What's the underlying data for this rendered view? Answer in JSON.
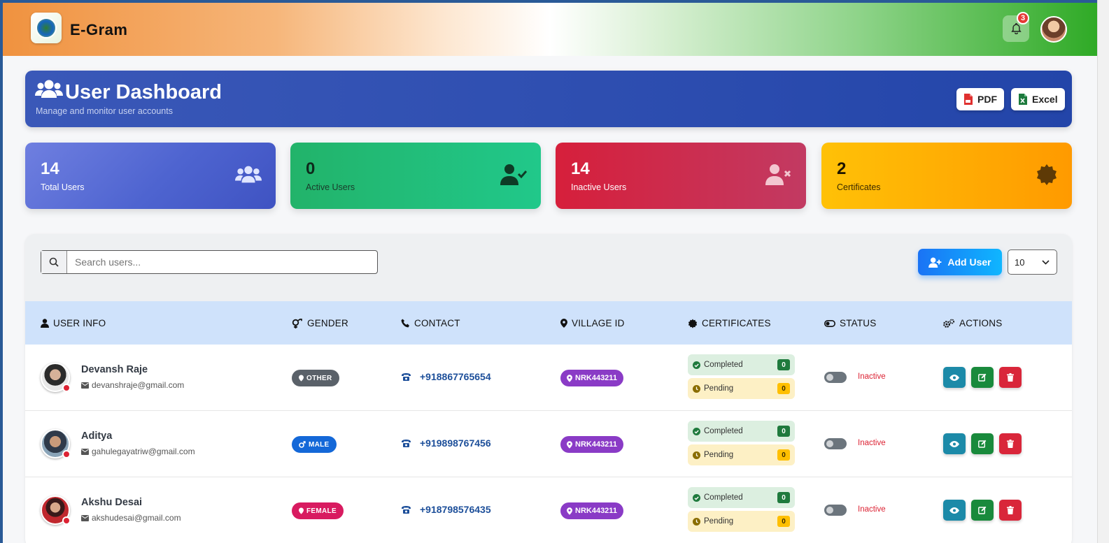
{
  "header": {
    "brand": "E-Gram",
    "notification_count": "3"
  },
  "hero": {
    "title": "User Dashboard",
    "subtitle": "Manage and monitor user accounts",
    "pdf_label": "PDF",
    "excel_label": "Excel"
  },
  "stats": [
    {
      "value": "14",
      "label": "Total Users"
    },
    {
      "value": "0",
      "label": "Active Users"
    },
    {
      "value": "14",
      "label": "Inactive Users"
    },
    {
      "value": "2",
      "label": "Certificates"
    }
  ],
  "toolbar": {
    "search_placeholder": "Search users...",
    "add_label": "Add User",
    "per_page": "10"
  },
  "columns": [
    "USER INFO",
    "GENDER",
    "CONTACT",
    "VILLAGE ID",
    "CERTIFICATES",
    "STATUS",
    "ACTIONS"
  ],
  "certificate_labels": {
    "completed": "Completed",
    "pending": "Pending"
  },
  "users": [
    {
      "name": "Devansh Raje",
      "email": "devanshraje@gmail.com",
      "gender": "OTHER",
      "gender_color": "#5a6169",
      "contact": "+918867765654",
      "village_id": "NRK443211",
      "completed": "0",
      "pending": "0",
      "status": "Inactive"
    },
    {
      "name": "Aditya",
      "email": "gahulegayatriw@gmail.com",
      "gender": "MALE",
      "gender_color": "#1468d8",
      "contact": "+919898767456",
      "village_id": "NRK443211",
      "completed": "0",
      "pending": "0",
      "status": "Inactive"
    },
    {
      "name": "Akshu Desai",
      "email": "akshudesai@gmail.com",
      "gender": "FEMALE",
      "gender_color": "#d81b60",
      "contact": "+918798576435",
      "village_id": "NRK443211",
      "completed": "0",
      "pending": "0",
      "status": "Inactive"
    }
  ],
  "colors": {
    "header_saffron": "#f0923f",
    "header_green": "#2faa26",
    "hero_blue": "#2f4fb1",
    "inactive": "#dc2233",
    "village_badge": "#8a3bc6"
  }
}
